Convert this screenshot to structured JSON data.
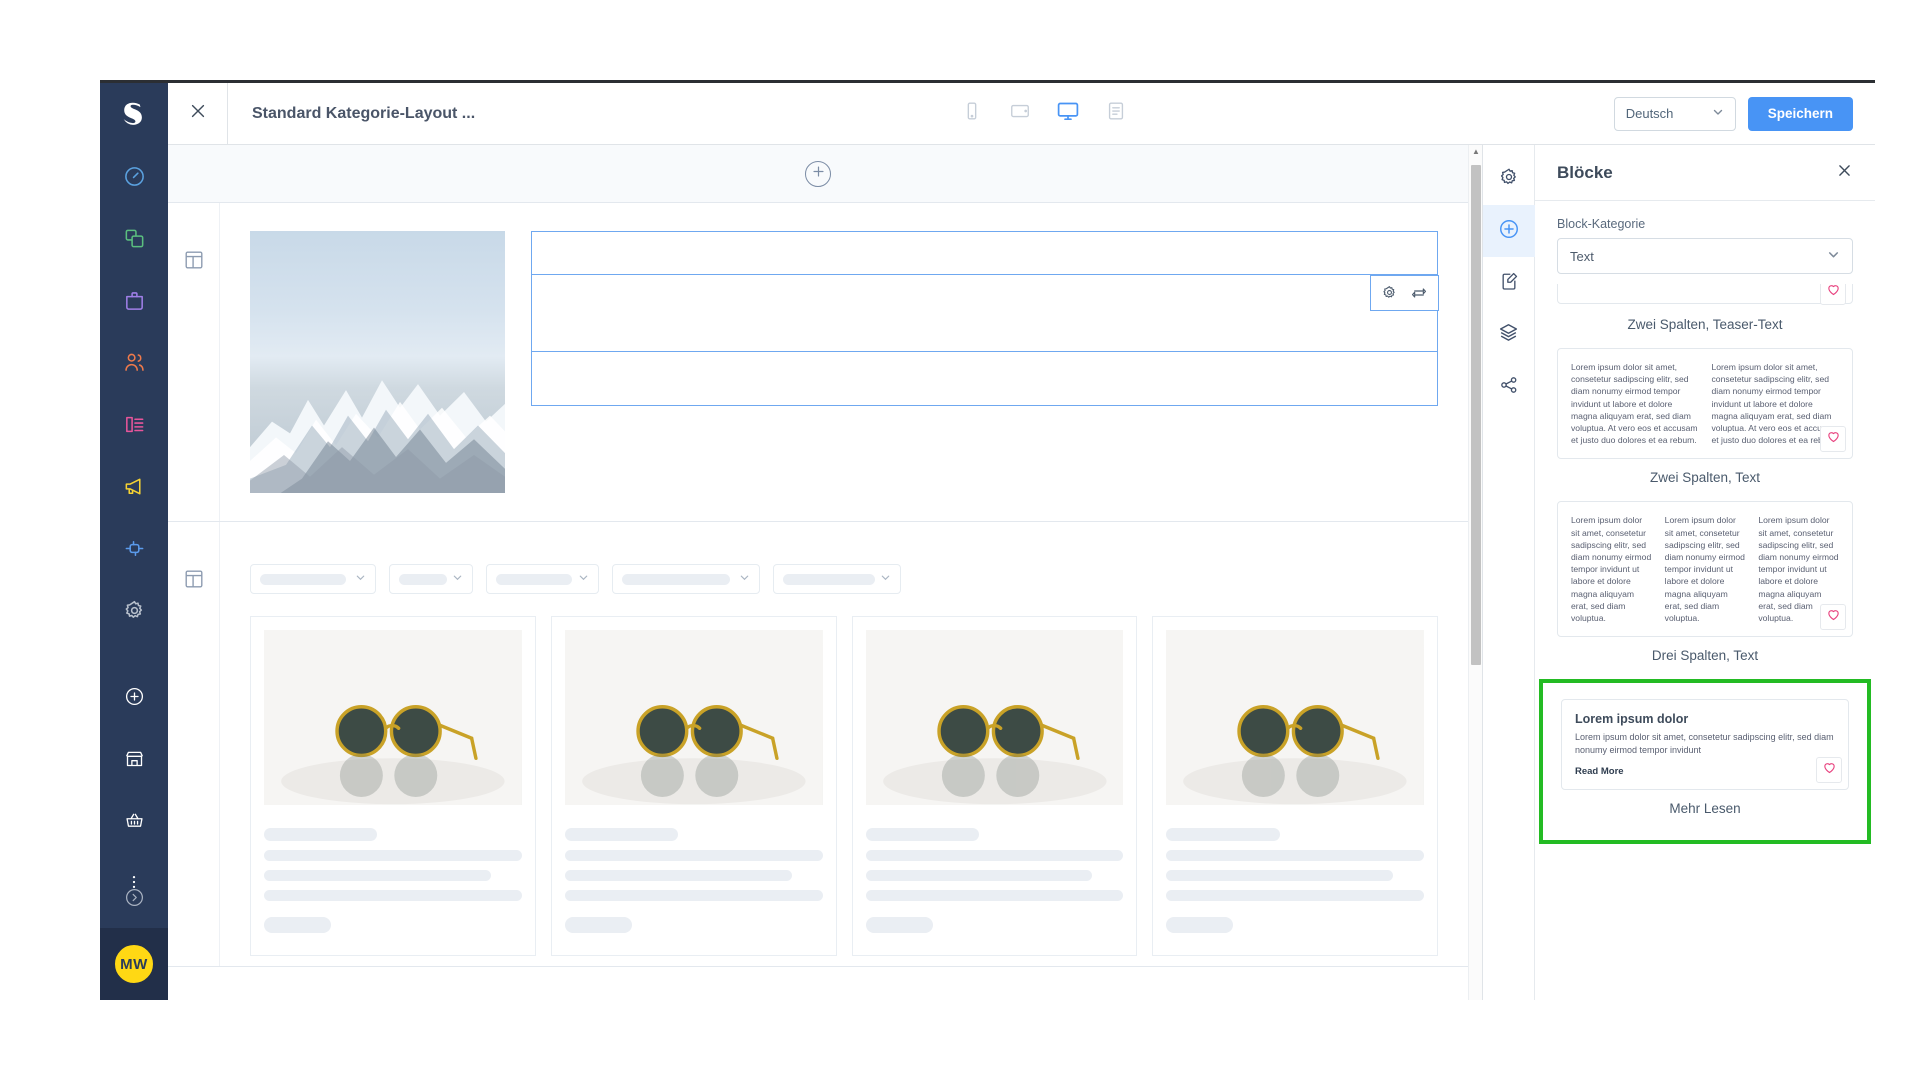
{
  "app": {
    "brand": "shopware",
    "avatar_initials": "MW"
  },
  "topbar": {
    "title": "Standard Kategorie-Layout ...",
    "language": "Deutsch",
    "save_label": "Speichern",
    "close_icon": "close-icon",
    "devices": [
      {
        "name": "mobile-view",
        "icon": "mobile-icon",
        "active": false
      },
      {
        "name": "tablet-view",
        "icon": "tablet-icon",
        "active": false
      },
      {
        "name": "desktop-view",
        "icon": "desktop-icon",
        "active": true
      },
      {
        "name": "form-view",
        "icon": "list-icon",
        "active": false
      }
    ],
    "accent_color": "#4894f5"
  },
  "sidebar": {
    "items": [
      {
        "name": "dashboard",
        "icon": "dashboard-icon",
        "color": "#5ba2e0"
      },
      {
        "name": "catalogues",
        "icon": "catalog-icon",
        "color": "#5bbf7f"
      },
      {
        "name": "orders",
        "icon": "bag-icon",
        "color": "#a07fe8"
      },
      {
        "name": "customers",
        "icon": "users-icon",
        "color": "#ef7a4b"
      },
      {
        "name": "content",
        "icon": "content-icon",
        "color": "#e8559b"
      },
      {
        "name": "marketing",
        "icon": "megaphone-icon",
        "color": "#f5d233"
      },
      {
        "name": "extensions",
        "icon": "plug-icon",
        "color": "#5b9bec"
      },
      {
        "name": "settings",
        "icon": "gear-icon",
        "color": "#b8c0cc"
      }
    ],
    "tools": [
      {
        "name": "add",
        "icon": "plus-circle-icon"
      },
      {
        "name": "shop",
        "icon": "store-icon"
      },
      {
        "name": "basket",
        "icon": "basket-icon"
      },
      {
        "name": "more",
        "icon": "more-vertical-icon"
      }
    ],
    "collapse": {
      "name": "expand",
      "icon": "chevron-right-circle-icon"
    }
  },
  "canvas": {
    "add_section": {
      "icon": "plus-circle-icon",
      "label": ""
    },
    "section_icon": "section-layout-icon",
    "selected_block": {
      "tools": [
        {
          "name": "block-settings",
          "icon": "gear-icon"
        },
        {
          "name": "block-replace",
          "icon": "swap-icon"
        }
      ]
    },
    "filters_count": 5,
    "filter_widths": [
      86,
      48,
      76,
      108,
      92
    ],
    "products_count": 4,
    "product_image_alt": "sunglasses"
  },
  "panel": {
    "title": "Blöcke",
    "close_icon": "close-icon",
    "category_label": "Block-Kategorie",
    "category_value": "Text",
    "rail": [
      {
        "name": "settings",
        "icon": "gear-icon",
        "active": false
      },
      {
        "name": "blocks",
        "icon": "plus-circle-icon",
        "active": true
      },
      {
        "name": "layout",
        "icon": "edit-document-icon",
        "active": false
      },
      {
        "name": "sections",
        "icon": "layers-icon",
        "active": false
      },
      {
        "name": "navigation",
        "icon": "share-network-icon",
        "active": false
      }
    ],
    "blocks": [
      {
        "name": "zwei-spalten-teaser-text",
        "caption": "Zwei Spalten, Teaser-Text",
        "type": "clipped"
      },
      {
        "name": "zwei-spalten-text",
        "caption": "Zwei Spalten, Text",
        "type": "two-column",
        "columns": [
          "Lorem ipsum dolor sit amet, consetetur sadipscing elitr, sed diam nonumy eirmod tempor invidunt ut labore et dolore magna aliquyam erat, sed diam voluptua. At vero eos et accusam et justo duo dolores et ea rebum.",
          "Lorem ipsum dolor sit amet, consetetur sadipscing elitr, sed diam nonumy eirmod tempor invidunt ut labore et dolore magna aliquyam erat, sed diam voluptua. At vero eos et accusam et justo duo dolores et ea rebum."
        ],
        "favorite_icon": "heart-icon"
      },
      {
        "name": "drei-spalten-text",
        "caption": "Drei Spalten, Text",
        "type": "three-column",
        "columns": [
          "Lorem ipsum dolor sit amet, consetetur sadipscing elitr, sed diam nonumy eirmod tempor invidunt ut labore et dolore magna aliquyam erat, sed diam voluptua.",
          "Lorem ipsum dolor sit amet, consetetur sadipscing elitr, sed diam nonumy eirmod tempor invidunt ut labore et dolore magna aliquyam erat, sed diam voluptua.",
          "Lorem ipsum dolor sit amet, consetetur sadipscing elitr, sed diam nonumy eirmod tempor invidunt ut labore et dolore magna aliquyam erat, sed diam voluptua."
        ],
        "favorite_icon": "heart-icon"
      },
      {
        "name": "mehr-lesen",
        "caption": "Mehr Lesen",
        "type": "teaser",
        "highlighted": true,
        "highlight_color": "#23bb23",
        "heading": "Lorem ipsum dolor",
        "body": "Lorem ipsum dolor sit amet, consetetur sadipscing elitr, sed diam nonumy eirmod tempor invidunt",
        "link": "Read More",
        "favorite_icon": "heart-icon"
      }
    ],
    "favorite_color": "#e8417e"
  }
}
